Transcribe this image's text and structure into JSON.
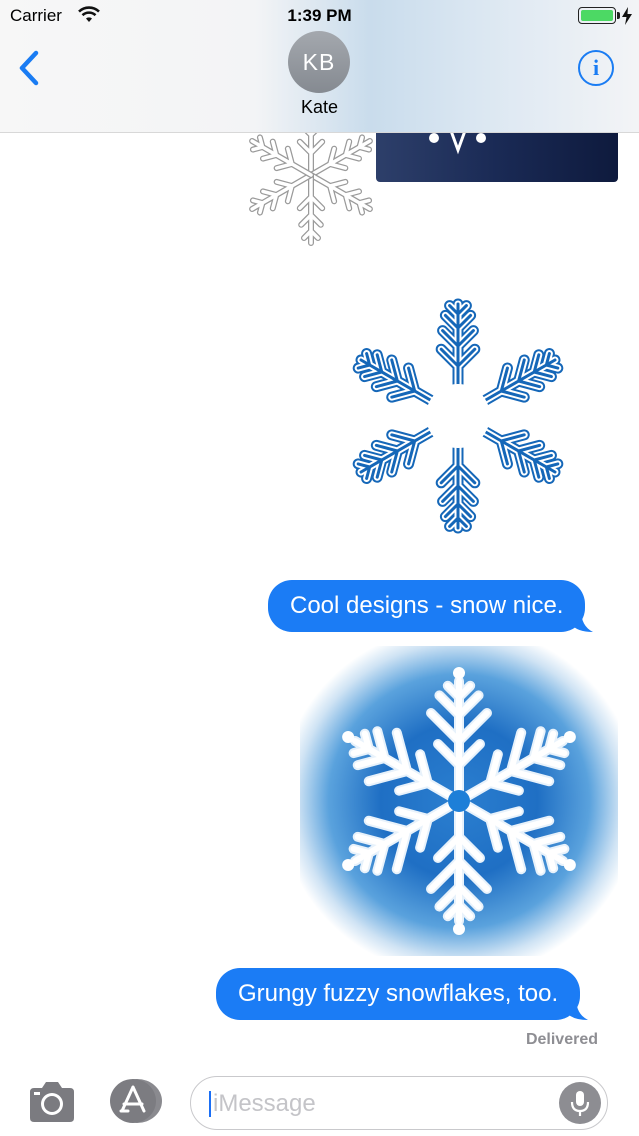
{
  "status_bar": {
    "carrier": "Carrier",
    "time": "1:39 PM",
    "battery_level": 1.0
  },
  "nav": {
    "back_icon": "chevron-left-icon",
    "avatar_initials": "KB",
    "contact_name": "Kate",
    "info_icon": "info-icon",
    "info_glyph": "i",
    "accent_color": "#1a7cf3"
  },
  "messages": [
    {
      "type": "sticker",
      "description_icon": "white-snowflake-sticker"
    },
    {
      "type": "sticker",
      "description_icon": "blue-outline-snowflake-sticker"
    },
    {
      "type": "text",
      "text": "Cool designs - snow nice."
    },
    {
      "type": "sticker",
      "description_icon": "fuzzy-blue-snowflake-sticker"
    },
    {
      "type": "text",
      "text": "Grungy fuzzy snowflakes, too."
    }
  ],
  "delivery_status": "Delivered",
  "input_bar": {
    "camera_icon": "camera-icon",
    "apps_icon": "app-store-icon",
    "placeholder": "iMessage",
    "mic_icon": "microphone-icon"
  },
  "colors": {
    "bubble": "#1b7cf5",
    "status_text": "#8e8e93"
  }
}
